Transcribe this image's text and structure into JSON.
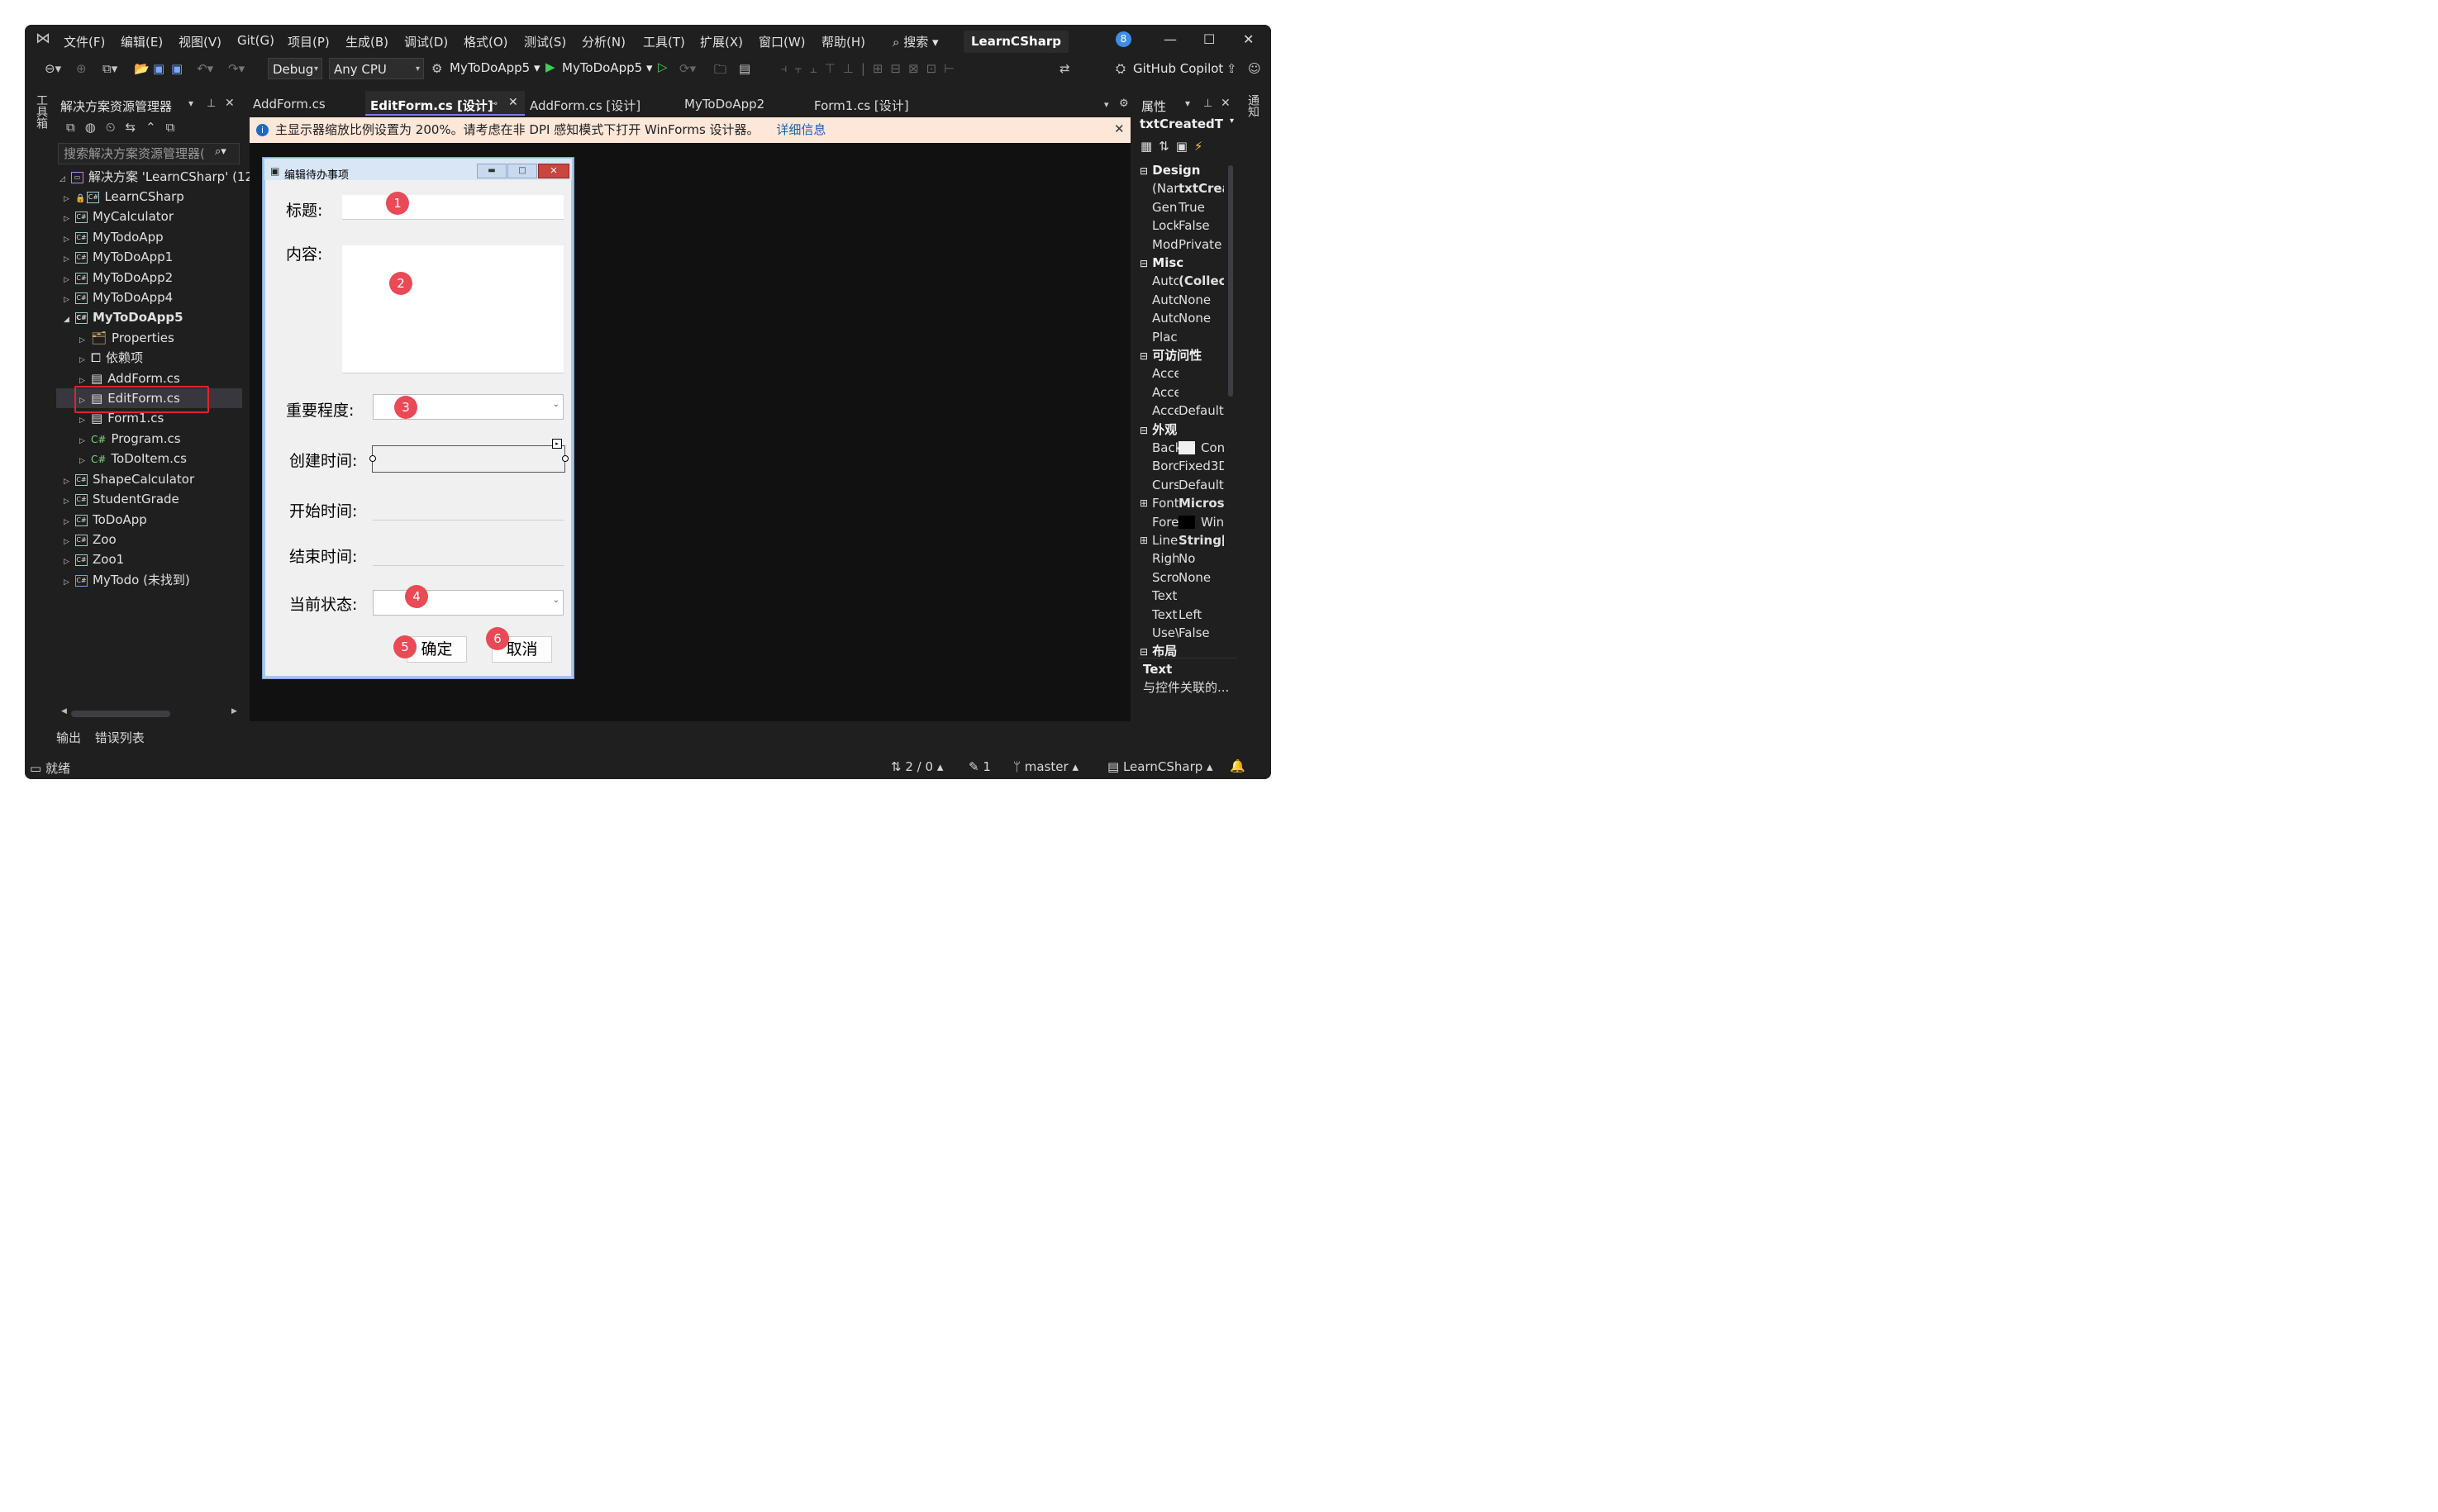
{
  "menu": {
    "items": [
      "文件(F)",
      "编辑(E)",
      "视图(V)",
      "Git(G)",
      "项目(P)",
      "生成(B)",
      "调试(D)",
      "格式(O)",
      "测试(S)",
      "分析(N)",
      "工具(T)",
      "扩展(X)",
      "窗口(W)",
      "帮助(H)"
    ],
    "search_label": "搜索",
    "solution_title": "LearnCSharp",
    "notification_count": "8"
  },
  "toolbar": {
    "config": "Debug",
    "platform": "Any CPU",
    "startup_project": "MyToDoApp5",
    "run_target": "MyToDoApp5",
    "copilot": "GitHub Copilot"
  },
  "left_strip": {
    "label": "工具箱"
  },
  "right_strip": {
    "label": "通知"
  },
  "solution_explorer": {
    "title": "解决方案资源管理器",
    "search_placeholder": "搜索解决方案资源管理器(",
    "root": "解决方案 'LearnCSharp' (12",
    "items": [
      {
        "label": "LearnCSharp"
      },
      {
        "label": "MyCalculator"
      },
      {
        "label": "MyTodoApp"
      },
      {
        "label": "MyToDoApp1"
      },
      {
        "label": "MyToDoApp2"
      },
      {
        "label": "MyToDoApp4"
      },
      {
        "label": "MyToDoApp5"
      },
      {
        "label": "Properties"
      },
      {
        "label": "依赖项"
      },
      {
        "label": "AddForm.cs"
      },
      {
        "label": "EditForm.cs"
      },
      {
        "label": "Form1.cs"
      },
      {
        "label": "Program.cs"
      },
      {
        "label": "ToDoItem.cs"
      },
      {
        "label": "ShapeCalculator"
      },
      {
        "label": "StudentGrade"
      },
      {
        "label": "ToDoApp"
      },
      {
        "label": "Zoo"
      },
      {
        "label": "Zoo1"
      },
      {
        "label": "MyTodo (未找到)"
      }
    ]
  },
  "tabs": [
    "AddForm.cs",
    "EditForm.cs [设计]",
    "AddForm.cs [设计]",
    "MyToDoApp2",
    "Form1.cs [设计]"
  ],
  "info_bar": {
    "message": "主显示器缩放比例设置为 200%。请考虑在非 DPI 感知模式下打开 WinForms 设计器。",
    "link": "详细信息"
  },
  "form": {
    "title": "编辑待办事项",
    "labels": {
      "title": "标题:",
      "content": "内容:",
      "priority": "重要程度:",
      "created": "创建时间:",
      "start": "开始时间:",
      "end": "结束时间:",
      "status": "当前状态:"
    },
    "ok": "确定",
    "cancel": "取消",
    "markers": [
      "1",
      "2",
      "3",
      "4",
      "5",
      "6"
    ]
  },
  "properties": {
    "title": "属性",
    "object": "txtCreatedT",
    "rows": [
      {
        "kind": "cat",
        "text": "Design"
      },
      {
        "kind": "row",
        "name": "(Nar",
        "value": "txtCrea",
        "bold": true
      },
      {
        "kind": "row",
        "name": "Gen",
        "value": "True"
      },
      {
        "kind": "row",
        "name": "Lock",
        "value": "False"
      },
      {
        "kind": "row",
        "name": "Mod",
        "value": "Private"
      },
      {
        "kind": "cat",
        "text": "Misc"
      },
      {
        "kind": "row",
        "name": "Autc",
        "value": "(Collect",
        "bold": true
      },
      {
        "kind": "row",
        "name": "Autc",
        "value": "None"
      },
      {
        "kind": "row",
        "name": "Autc",
        "value": "None"
      },
      {
        "kind": "row",
        "name": "Plac",
        "value": ""
      },
      {
        "kind": "cat",
        "text": "可访问性"
      },
      {
        "kind": "row",
        "name": "Acce",
        "value": ""
      },
      {
        "kind": "row",
        "name": "Acce",
        "value": ""
      },
      {
        "kind": "row",
        "name": "Acce",
        "value": "Default"
      },
      {
        "kind": "cat",
        "text": "外观"
      },
      {
        "kind": "row",
        "name": "Back",
        "value": "Con",
        "swatch": "#f0f0f0"
      },
      {
        "kind": "row",
        "name": "Borc",
        "value": "Fixed3D"
      },
      {
        "kind": "row",
        "name": "Curs",
        "value": "Default"
      },
      {
        "kind": "row",
        "name": "Font",
        "value": "Microsc",
        "bold": true,
        "expand": true
      },
      {
        "kind": "row",
        "name": "Fore",
        "value": "Win",
        "swatch": "#000000"
      },
      {
        "kind": "row",
        "name": "Line:",
        "value": "String[]",
        "bold": true,
        "expand": true
      },
      {
        "kind": "row",
        "name": "Righ",
        "value": "No"
      },
      {
        "kind": "row",
        "name": "Scro",
        "value": "None"
      },
      {
        "kind": "row",
        "name": "Text",
        "value": ""
      },
      {
        "kind": "row",
        "name": "Text.",
        "value": "Left"
      },
      {
        "kind": "row",
        "name": "Use\\",
        "value": "False"
      },
      {
        "kind": "cat",
        "text": "布局"
      }
    ],
    "desc_title": "Text",
    "desc_text": "与控件关联的..."
  },
  "bottom_tabs": [
    "输出",
    "错误列表"
  ],
  "status": {
    "ready": "就绪",
    "changes": "2 / 0",
    "edits": "1",
    "branch": "master",
    "repo": "LearnCSharp"
  },
  "colors": {
    "accent": "#7a7af5",
    "info_bg": "#fde7d9",
    "marker": "#e94a55",
    "highlight_box": "#e0242f"
  }
}
